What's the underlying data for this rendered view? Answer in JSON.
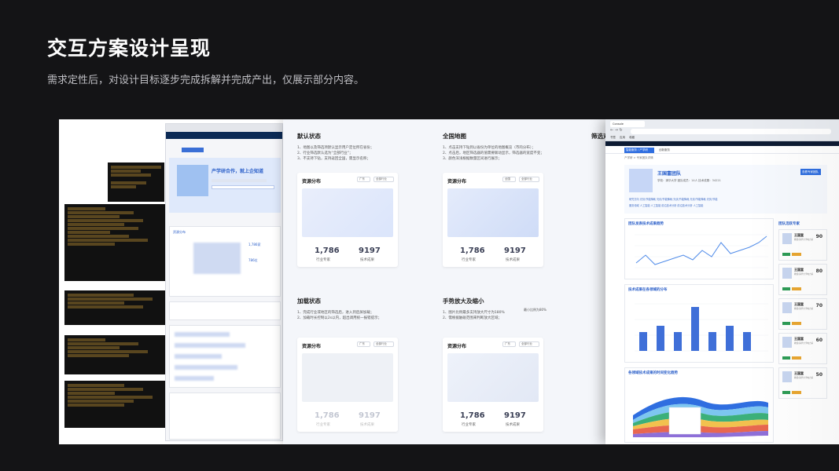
{
  "hero": {
    "title": "交互方案设计呈现",
    "subtitle": "需求定性后，对设计目标逐步完成拆解并完成产出，仅展示部分内容。"
  },
  "wireframe": {
    "banner_title": "产学研合作，就上企知道",
    "section_label": "资源分布",
    "stat_a": "1,786家",
    "stat_b": "786位"
  },
  "states": {
    "default": {
      "title": "默认状态",
      "lines": [
        "1、地图以及筛选项默认显示用户定位所在省份；",
        "2、行业筛选默认选为“全部行业”；",
        "3、不支持下钻，支持返回全国，需显示名称；"
      ],
      "card": {
        "title": "资源分布",
        "sel_a": "广东",
        "sel_b": "全部行业",
        "n1": "1,786",
        "c1": "行业专家",
        "n2": "9197",
        "c2": "技术成果"
      }
    },
    "national": {
      "title": "全国地图",
      "lines": [
        "1、点击支持下钻到以省份为单位的地图概览（市的分布）；",
        "2、点击后，地区筛选器的值需要联动显示，筛选器的宽度不变；",
        "3、颜色深浅根据数量区间进行展示；"
      ],
      "card": {
        "title": "资源分布",
        "sel_a": "全国",
        "sel_b": "全部行业",
        "n1": "1,786",
        "c1": "行业专家",
        "n2": "9197",
        "c2": "技术成果"
      }
    },
    "filter_partial": {
      "title": "筛选对"
    },
    "loading": {
      "title": "加载状态",
      "lines": [
        "1、完成行业或地区的筛选后，进入到后屏加载；",
        "2、加载时长控制以2s以内，超出调用统一报错提示；"
      ],
      "card": {
        "title": "资源分布",
        "sel_a": "广东",
        "sel_b": "全部行业",
        "n1": "1,786",
        "c1": "行业专家",
        "n2": "9197",
        "c2": "技术成果"
      }
    },
    "gesture": {
      "title": "手势放大及缩小",
      "lines": [
        "1、图片比例最多支持放大尺寸为180%",
        "2、需根据触碰范围来判断放大区域；"
      ],
      "side_note": "最小比例为80%",
      "card": {
        "title": "资源分布",
        "sel_a": "广东",
        "sel_b": "全部行业",
        "n1": "1,786",
        "c1": "行业专家",
        "n2": "9197",
        "c2": "技术成果"
      }
    }
  },
  "hifi": {
    "tab_label": "Console",
    "bookmarks": [
      "书签",
      "应用",
      "收藏"
    ],
    "nav_active": "智能服务 / 产学研",
    "nav_item": "创新服务",
    "breadcrumb": "产学研 > 专家团队详情",
    "team_name": "王国富团队",
    "team_meta": "学校：清华大学      团队成员：14人      技术成果：34221",
    "action_button": "查看专家团队",
    "tags_line1": "研究方向    光伏/节能降耗    光伏/节能降耗    光伏/节能降耗    光伏/节能降耗    光伏/节能",
    "tags_line2": "服务领域    人工智能    人工智能    前沿技术分析    前沿技术分析    人工智能",
    "chart1_title": "团队发表技术成果趋势",
    "chart2_title": "技术成果在各领域的分布",
    "chart3_title": "各领域技术成果的时间变化趋势",
    "experts_title": "团队活跃专家",
    "experts": [
      {
        "name": "王国富",
        "score": "90"
      },
      {
        "name": "王国富",
        "score": "80"
      },
      {
        "name": "王国富",
        "score": "70"
      },
      {
        "name": "王国富",
        "score": "60"
      },
      {
        "name": "王国富",
        "score": "50"
      }
    ],
    "expert_desc": "教授/清华大学电力系"
  },
  "colors": {
    "brand": "#2F6EE0",
    "title": "#1F58C8",
    "hero_bg": "#141416",
    "board_bg": "#EEF0F4",
    "stream": [
      "#2F6EE0",
      "#7DC6F0",
      "#3BB07A",
      "#F2C14E",
      "#E8674F",
      "#8E6FD8"
    ]
  }
}
